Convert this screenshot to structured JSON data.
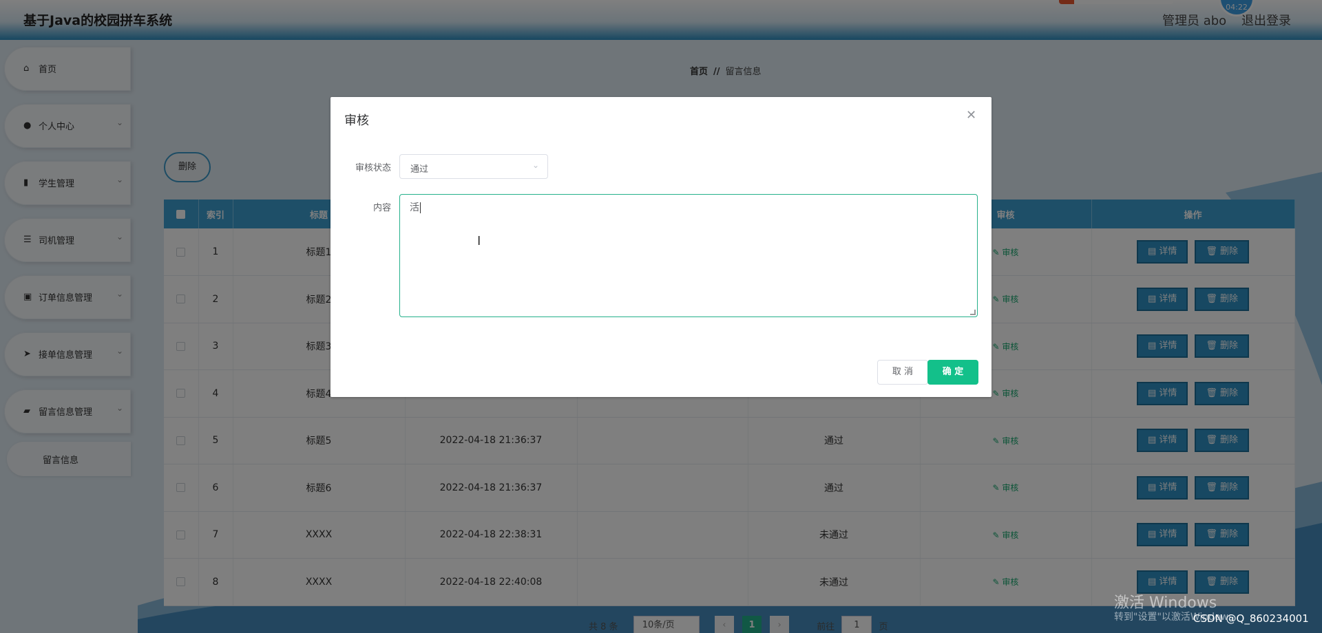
{
  "header": {
    "app_title": "基于Java的校园拼车系统",
    "clock_text": "04:22",
    "user_text": "管理员 abo",
    "logout_label": "退出登录"
  },
  "sidebar": {
    "items": [
      {
        "label": "首页",
        "icon": "home-icon"
      },
      {
        "label": "个人中心",
        "icon": "user-icon"
      },
      {
        "label": "学生管理",
        "icon": "book-icon"
      },
      {
        "label": "司机管理",
        "icon": "list-icon"
      },
      {
        "label": "订单信息管理",
        "icon": "chart-icon"
      },
      {
        "label": "接单信息管理",
        "icon": "send-icon"
      },
      {
        "label": "留言信息管理",
        "icon": "briefcase-icon"
      }
    ],
    "sub_item": "留言信息"
  },
  "breadcrumb": {
    "home": "首页",
    "sep": "//",
    "current": "留言信息"
  },
  "toolbar": {
    "delete_label": "删除"
  },
  "table": {
    "headers": [
      "索引",
      "标题",
      "审核",
      "操作"
    ],
    "rows": [
      {
        "idx": "1",
        "title": "标题1",
        "time": "",
        "reply": "",
        "status": ""
      },
      {
        "idx": "2",
        "title": "标题2",
        "time": "",
        "reply": "",
        "status": ""
      },
      {
        "idx": "3",
        "title": "标题3",
        "time": "",
        "reply": "",
        "status": ""
      },
      {
        "idx": "4",
        "title": "标题4",
        "time": "",
        "reply": "",
        "status": ""
      },
      {
        "idx": "5",
        "title": "标题5",
        "time": "2022-04-18 21:36:37",
        "reply": "",
        "status": "通过"
      },
      {
        "idx": "6",
        "title": "标题6",
        "time": "2022-04-18 21:36:37",
        "reply": "",
        "status": "通过"
      },
      {
        "idx": "7",
        "title": "XXXX",
        "time": "2022-04-18 22:38:31",
        "reply": "",
        "status": "未通过"
      },
      {
        "idx": "8",
        "title": "XXXX",
        "time": "2022-04-18 22:40:08",
        "reply": "",
        "status": "未通过"
      }
    ],
    "audit_label": "审核",
    "detail_label": "详情",
    "row_delete_label": "删除"
  },
  "pagination": {
    "total": "共 8 条",
    "page_size": "10条/页",
    "current_page": "1",
    "goto_prefix": "前往",
    "goto_value": "1",
    "goto_suffix": "页"
  },
  "dialog": {
    "title": "审核",
    "status_label": "审核状态",
    "status_value": "通过",
    "content_label": "内容",
    "content_value": "活",
    "cancel_label": "取 消",
    "ok_label": "确 定"
  },
  "watermark": {
    "line1": "激活 Windows",
    "line2": "转到\"设置\"以激活Windows",
    "csdn": "CSDN @Q_860234001"
  },
  "colors": {
    "accent": "#3d9fd1",
    "confirm": "#13c08a",
    "audit_link": "#17a86f"
  }
}
